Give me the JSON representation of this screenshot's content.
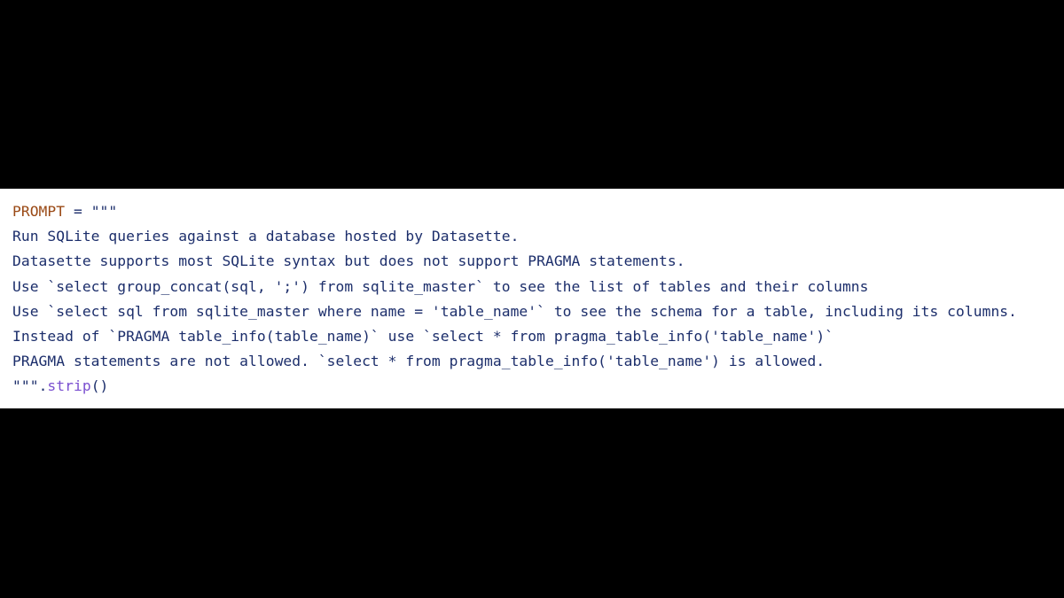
{
  "colors": {
    "background": "#000000",
    "panel": "#ffffff",
    "variable": "#9a4a16",
    "text": "#1c2e6b",
    "method": "#7a4fd0"
  },
  "code": {
    "assignment": {
      "variable": "PROMPT",
      "operator": " = ",
      "open_quote": "\"\"\""
    },
    "lines": [
      "Run SQLite queries against a database hosted by Datasette.",
      "Datasette supports most SQLite syntax but does not support PRAGMA statements.",
      "Use `select group_concat(sql, ';') from sqlite_master` to see the list of tables and their columns",
      "Use `select sql from sqlite_master where name = 'table_name'` to see the schema for a table, including its columns.",
      "Instead of `PRAGMA table_info(table_name)` use `select * from pragma_table_info('table_name')`",
      "PRAGMA statements are not allowed. `select * from pragma_table_info('table_name') is allowed."
    ],
    "closing": {
      "close_quote": "\"\"\"",
      "dot": ".",
      "method": "strip",
      "parens": "()"
    }
  }
}
